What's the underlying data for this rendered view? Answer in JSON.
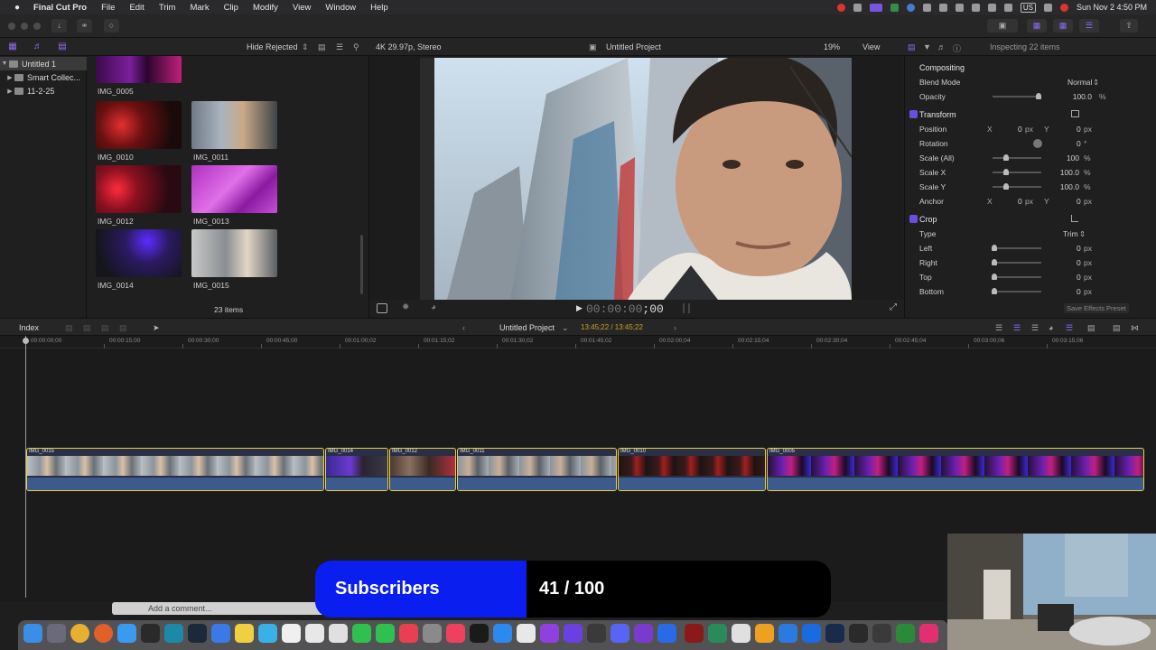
{
  "menubar": {
    "app_name": "Final Cut Pro",
    "items": [
      "File",
      "Edit",
      "Trim",
      "Mark",
      "Clip",
      "Modify",
      "View",
      "Window",
      "Help"
    ],
    "keyboard": "US",
    "datetime": "Sun Nov 2  4:50 PM"
  },
  "browser": {
    "filter": "Hide Rejected",
    "item_count": "23 items",
    "clips": [
      {
        "name": "IMG_0005"
      },
      {
        "name": "IMG_0010"
      },
      {
        "name": "IMG_0011"
      },
      {
        "name": "IMG_0012"
      },
      {
        "name": "IMG_0013"
      },
      {
        "name": "IMG_0014"
      },
      {
        "name": "IMG_0015"
      }
    ]
  },
  "libraries": {
    "items": [
      {
        "label": "Untitled 1"
      },
      {
        "label": "Smart Collec..."
      },
      {
        "label": "11-2-25"
      }
    ]
  },
  "viewer": {
    "format": "4K 29.97p, Stereo",
    "project": "Untitled Project",
    "zoom": "19%",
    "view_menu": "View",
    "timecode_dim": "00:00:00",
    "timecode_frames": ";00"
  },
  "inspector": {
    "header": "Inspecting 22 items",
    "compositing_title": "Compositing",
    "blend_mode_label": "Blend Mode",
    "blend_mode_value": "Normal",
    "opacity_label": "Opacity",
    "opacity_value": "100.0",
    "opacity_unit": "%",
    "transform_title": "Transform",
    "position_label": "Position",
    "position_x": "0",
    "position_y": "0",
    "px": "px",
    "x": "X",
    "y": "Y",
    "rotation_label": "Rotation",
    "rotation_value": "0",
    "degree": "°",
    "scale_all_label": "Scale (All)",
    "scale_all_value": "100",
    "scale_x_label": "Scale X",
    "scale_x_value": "100.0",
    "scale_y_label": "Scale Y",
    "scale_y_value": "100.0",
    "percent": "%",
    "anchor_label": "Anchor",
    "anchor_x": "0",
    "anchor_y": "0",
    "crop_title": "Crop",
    "type_label": "Type",
    "type_value": "Trim",
    "left_label": "Left",
    "right_label": "Right",
    "top_label": "Top",
    "bottom_label": "Bottom",
    "zero": "0",
    "save_preset": "Save Effects Preset"
  },
  "timeline": {
    "index_label": "Index",
    "project_name": "Untitled Project",
    "duration": "13:45;22 / 13:45;22",
    "ruler_labels": [
      "00:00:00;00",
      "00:00:15;00",
      "00:00:30;00",
      "00:00:45;00",
      "00:01:00;02",
      "00:01:15;02",
      "00:01:30;02",
      "00:01:45;02",
      "00:02:00;04",
      "00:02:15;04",
      "00:02:30;04",
      "00:02:45;04",
      "00:03:00;06",
      "00:03:15;06"
    ],
    "clips": [
      {
        "name": "IMG_0015"
      },
      {
        "name": "IMG_0014"
      },
      {
        "name": "IMG_0012"
      },
      {
        "name": "IMG_0011"
      },
      {
        "name": "IMG_0010"
      },
      {
        "name": "IMG_0005"
      }
    ]
  },
  "comment": {
    "placeholder": "Add a comment..."
  },
  "overlay": {
    "label": "Subscribers",
    "count_text": "41 / 100",
    "current": 41,
    "goal": 100,
    "colors": {
      "label_bg": "#0a1ef0",
      "count_bg": "#000000"
    }
  },
  "colors": {
    "accent": "#6b4ee0",
    "clip_border": "#e8d14a",
    "range": "#c9a227"
  }
}
